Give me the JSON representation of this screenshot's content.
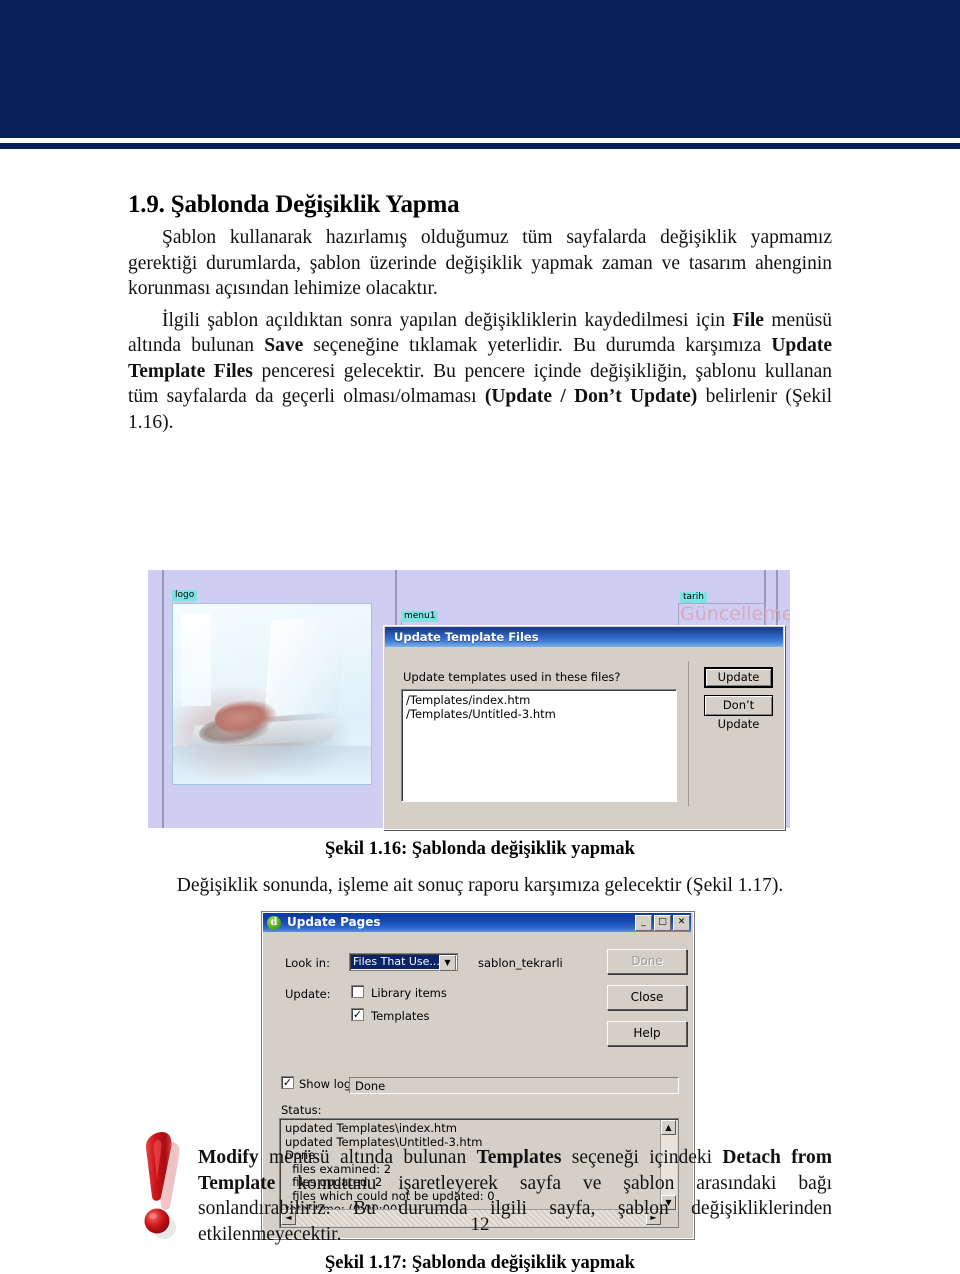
{
  "document": {
    "page_number": "12",
    "section_number": "1.9.",
    "section_title": "Şablonda Değişiklik Yapma",
    "paragraph1": "Şablon kullanarak hazırlamış olduğumuz tüm sayfalarda değişiklik yapmamız gerektiği durumlarda, şablon üzerinde değişiklik yapmak zaman ve tasarım ahenginin korunması açısından lehimize olacaktır.",
    "paragraph2_parts": {
      "t1": "İlgili şablon açıldıktan sonra yapılan değişikliklerin kaydedilmesi için ",
      "b1": "File",
      "t2": " menüsü altında bulunan ",
      "b2": "Save",
      "t3": " seçeneğine tıklamak yeterlidir. Bu durumda karşımıza ",
      "b3": "Update Template Files",
      "t4": " penceresi gelecektir. Bu pencere içinde değişikliğin, şablonu kullanan tüm sayfalarda da geçerli olması/olmaması ",
      "b4": "(Update / Don’t Update)",
      "t5": " belirlenir (Şekil 1.16)."
    },
    "figure1_caption": "Şekil 1.16: Şablonda değişiklik yapmak",
    "mid_text": "Değişiklik sonunda, işleme ait sonuç raporu karşımıza gelecektir (Şekil 1.17).",
    "figure2_caption": "Şekil 1.17: Şablonda değişiklik yapmak",
    "warning_parts": {
      "b1": "Modify",
      "t1": " menüsü altında bulunan ",
      "b2": "Templates",
      "t2": " seçeneği içindeki ",
      "b3": "Detach from Template",
      "t3": " komutunu işaretleyerek sayfa ve şablon arasındaki bağı sonlandırabiliriz. Bu durumda ilgili sayfa, şablon değişikliklerinden etkilenmeyecektir."
    }
  },
  "figure1": {
    "dreamweaver_page": {
      "tag_logo": "logo",
      "tag_menu1": "menu1",
      "tag_tarih": "tarih",
      "text_guncelleme": "Güncelleme"
    },
    "dialog": {
      "title": "Update Template Files",
      "question": "Update templates used in these files?",
      "file_list": [
        "/Templates/index.htm",
        "/Templates/Untitled-3.htm"
      ],
      "buttons": {
        "update": "Update",
        "dont_update": "Don’t Update"
      }
    }
  },
  "figure2": {
    "title": "Update Pages",
    "window_buttons": {
      "minimize": "_",
      "maximize": "□",
      "close": "✕"
    },
    "look_in_label": "Look in:",
    "look_in_value": "Files That Use...",
    "look_in_target": "sablon_tekrarli",
    "update_label": "Update:",
    "checkbox_library_items": {
      "label": "Library items",
      "checked": false,
      "mark": ""
    },
    "checkbox_templates": {
      "label": "Templates",
      "checked": true,
      "mark": "✓"
    },
    "show_log": {
      "label": "Show log",
      "checked": true,
      "mark": "✓"
    },
    "log_field_value": "Done",
    "status_label": "Status:",
    "status_text": "updated Templates\\index.htm\nupdated Templates\\Untitled-3.htm\nDone.\n  files examined: 2\n  files updated: 2\n  files which could not be updated: 0\ntotal time: (0:00:00)",
    "buttons": {
      "done": "Done",
      "close": "Close",
      "help": "Help"
    },
    "scroll_up": "▲",
    "scroll_down": "▼",
    "scroll_left": "◄",
    "scroll_right": "►"
  },
  "colors": {
    "header_band": "#06205c",
    "dialog_face": "#d4d0c8",
    "titlebar_blue": "#1b3f8f",
    "dw_page_bg": "#cfcdf2",
    "tag_highlight": "#7fe3e3",
    "warning_red": "#d0151b"
  }
}
